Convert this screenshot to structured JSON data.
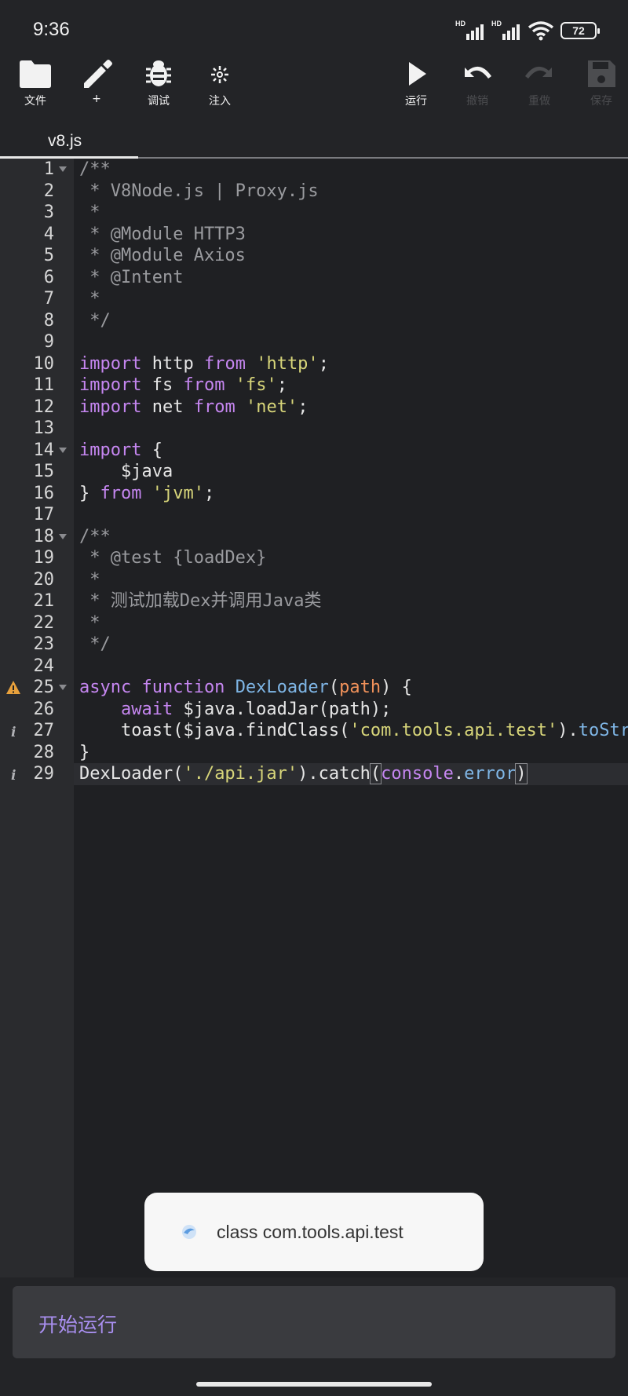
{
  "status": {
    "time": "9:36",
    "battery": "72",
    "hd1": "HD",
    "hd2": "HD"
  },
  "toolbar": {
    "file": "文件",
    "add": "+",
    "debug": "调试",
    "inject": "注入",
    "run": "运行",
    "undo": "撤销",
    "redo": "重做",
    "save": "保存"
  },
  "tabs": [
    {
      "label": "v8.js"
    }
  ],
  "editor": {
    "line_numbers": [
      "1",
      "2",
      "3",
      "4",
      "5",
      "6",
      "7",
      "8",
      "9",
      "10",
      "11",
      "12",
      "13",
      "14",
      "15",
      "16",
      "17",
      "18",
      "19",
      "20",
      "21",
      "22",
      "23",
      "24",
      "25",
      "26",
      "27",
      "28",
      "29"
    ],
    "lines": [
      "/**",
      " * V8Node.js | Proxy.js",
      " *",
      " * @Module HTTP3",
      " * @Module Axios",
      " * @Intent",
      " *",
      " */",
      "",
      "import http from 'http';",
      "import fs from 'fs';",
      "import net from 'net';",
      "",
      "import {",
      "    $java",
      "} from 'jvm';",
      "",
      "/**",
      " * @test {loadDex}",
      " *",
      " * 测试加载Dex并调用Java类",
      " *",
      " */",
      "",
      "async function DexLoader(path) {",
      "    await $java.loadJar(path);",
      "    toast($java.findClass('com.tools.api.test').toString());",
      "}",
      "DexLoader('./api.jar').catch(console.error)"
    ]
  },
  "toast": {
    "text": "class com.tools.api.test"
  },
  "run_button": {
    "label": "开始运行"
  },
  "colors": {
    "background": "#232427",
    "editor_bg": "#1f2023",
    "gutter_bg": "#2a2b2e",
    "keyword": "#c586f0",
    "string": "#d8d67a",
    "function": "#7fb6e6",
    "param": "#f0915a",
    "comment": "#9a9b9f",
    "run_label": "#a98ff0",
    "warning": "#e8a13c"
  }
}
